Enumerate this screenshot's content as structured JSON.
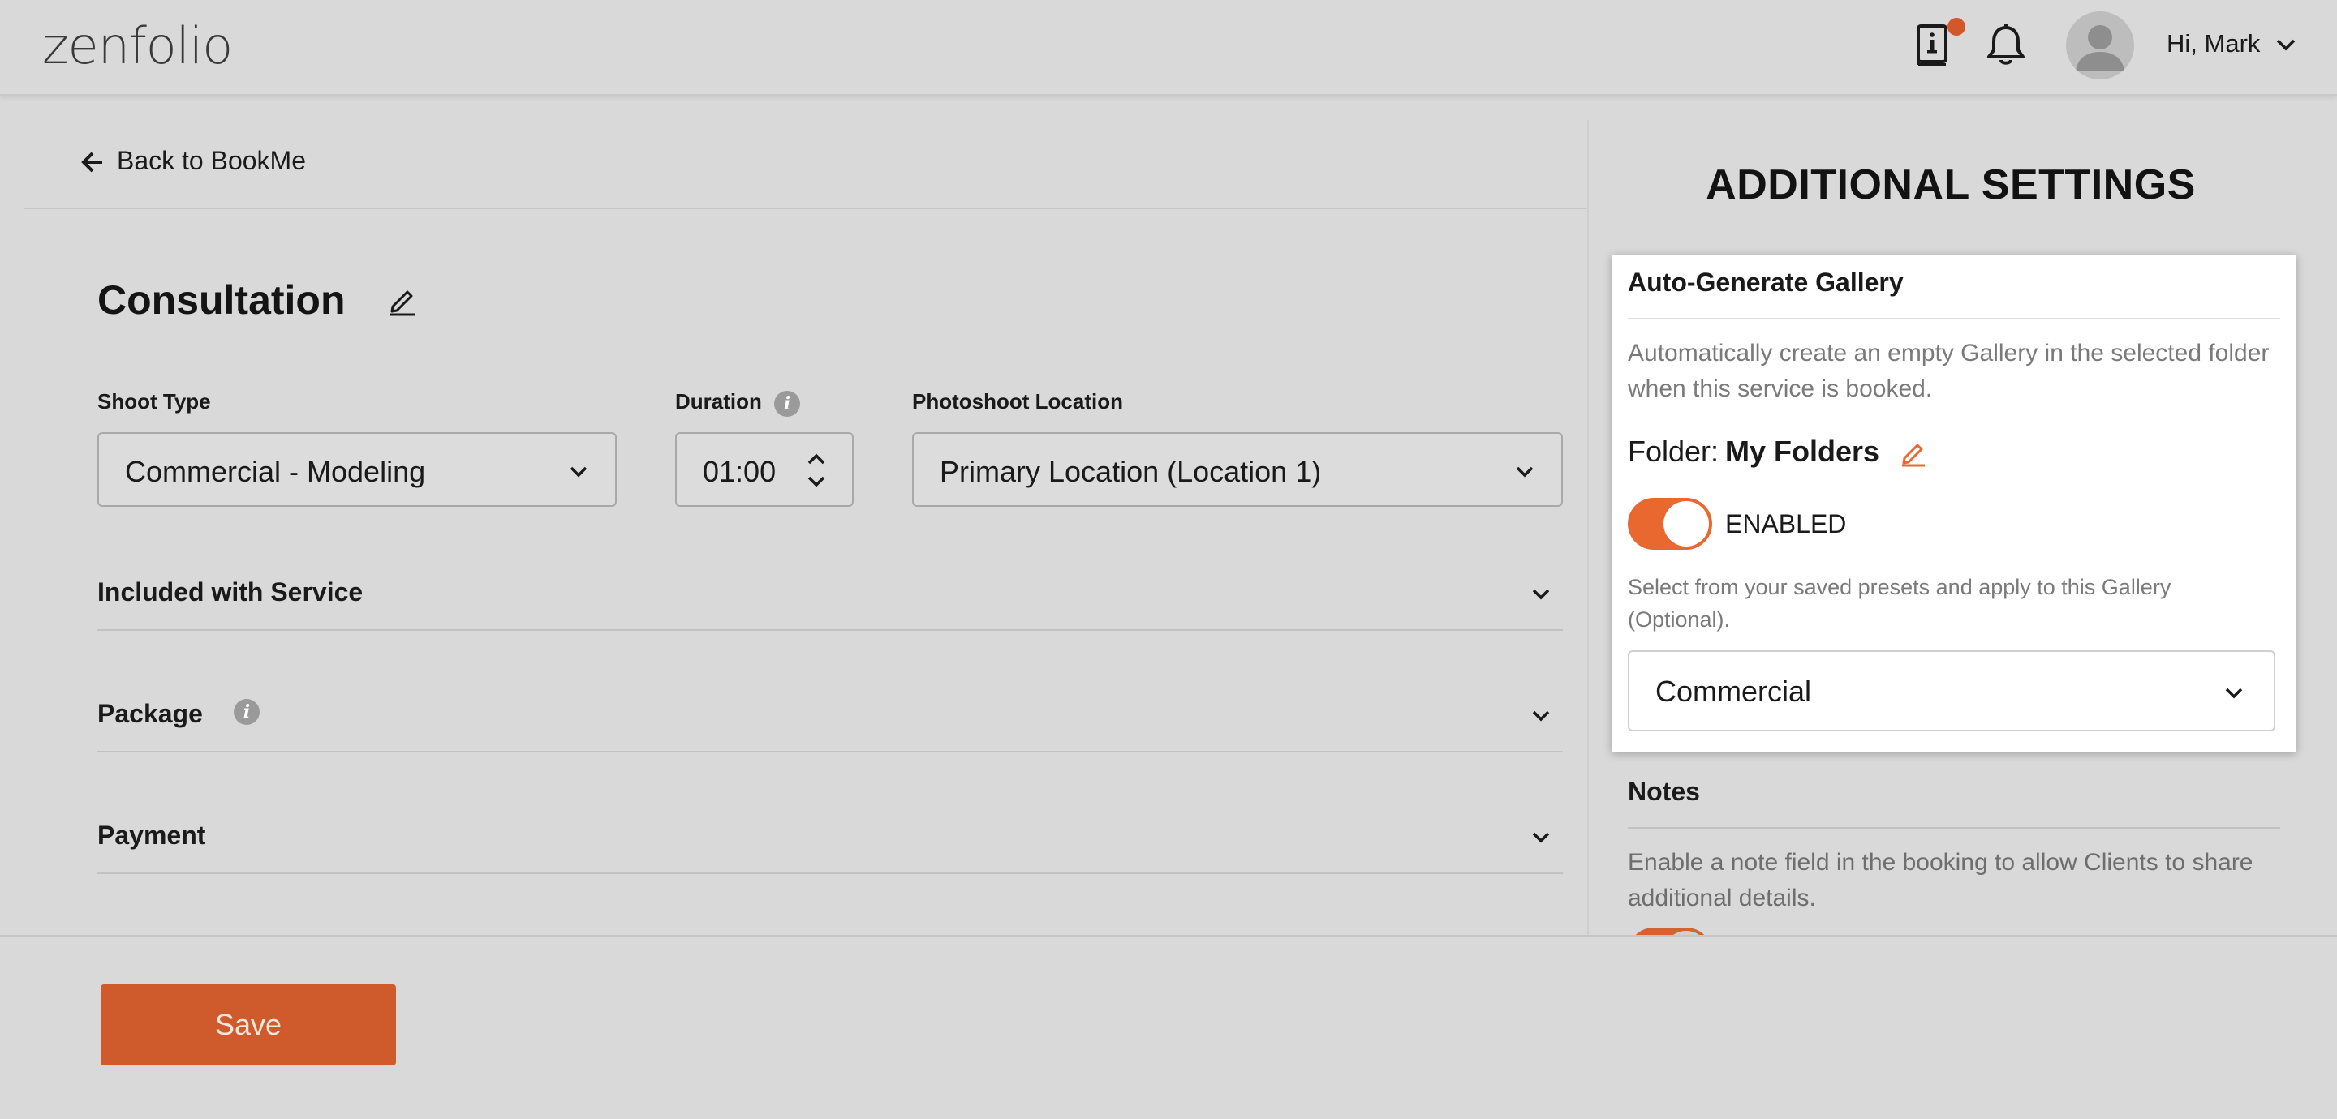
{
  "app": {
    "logo_text": "zenfolio"
  },
  "header": {
    "greeting": "Hi, Mark"
  },
  "nav": {
    "back_label": "Back to BookMe"
  },
  "service": {
    "title": "Consultation",
    "shoot_type_label": "Shoot Type",
    "shoot_type_value": "Commercial - Modeling",
    "duration_label": "Duration",
    "duration_value": "01:00",
    "location_label": "Photoshoot Location",
    "location_value": "Primary Location (Location 1)"
  },
  "sections": [
    {
      "title": "Included with Service"
    },
    {
      "title": "Package"
    },
    {
      "title": "Payment"
    }
  ],
  "footer": {
    "save_label": "Save"
  },
  "settings": {
    "title": "ADDITIONAL SETTINGS",
    "gallery": {
      "heading": "Auto-Generate Gallery",
      "description": "Automatically create an empty Gallery in the selected folder when this service is booked.",
      "folder_label": "Folder:",
      "folder_name": "My Folders",
      "toggle_label": "ENABLED",
      "enabled": true,
      "preset_description": "Select from your saved presets and apply to this Gallery (Optional).",
      "preset_value": "Commercial"
    },
    "notes": {
      "heading": "Notes",
      "description": "Enable a note field in the booking to allow Clients to share additional details.",
      "enabled": true
    }
  },
  "colors": {
    "accent": "#e8682f",
    "save_button": "#cf5a2b",
    "background": "#d9d9d9",
    "notification_dot": "#d4572a"
  },
  "icons": [
    "guide-book-icon",
    "bell-icon",
    "user-avatar-icon",
    "chevron-down-icon",
    "arrow-left-icon",
    "pencil-icon",
    "info-icon"
  ]
}
